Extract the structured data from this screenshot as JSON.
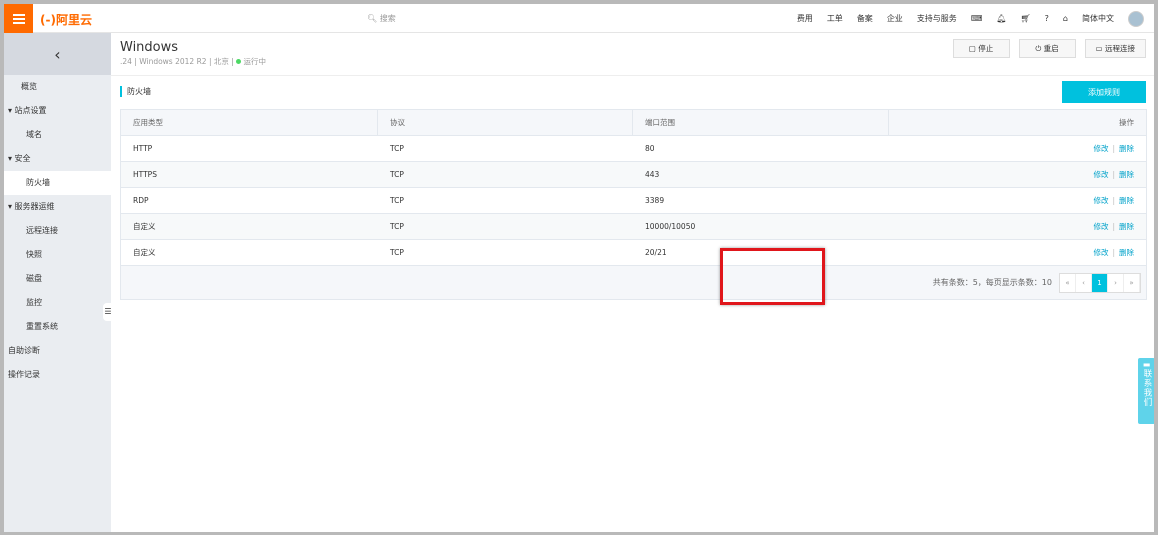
{
  "header": {
    "logo": "(-)阿里云",
    "search_placeholder": "搜索",
    "nav": [
      "费用",
      "工单",
      "备案",
      "企业",
      "支持与服务"
    ],
    "language": "简体中文"
  },
  "sidebar": {
    "items": [
      {
        "label": "概览",
        "type": "item"
      },
      {
        "label": "▾ 站点设置",
        "type": "grp"
      },
      {
        "label": "域名",
        "type": "sub"
      },
      {
        "label": "▾ 安全",
        "type": "grp"
      },
      {
        "label": "防火墙",
        "type": "sub",
        "active": true
      },
      {
        "label": "▾ 服务器运维",
        "type": "grp"
      },
      {
        "label": "远程连接",
        "type": "sub"
      },
      {
        "label": "快照",
        "type": "sub"
      },
      {
        "label": "磁盘",
        "type": "sub"
      },
      {
        "label": "监控",
        "type": "sub"
      },
      {
        "label": "重置系统",
        "type": "sub"
      },
      {
        "label": "自助诊断",
        "type": "grp"
      },
      {
        "label": "操作记录",
        "type": "grp"
      }
    ]
  },
  "instance": {
    "title": "Windows",
    "ip": ".24",
    "os": "Windows 2012 R2",
    "region": "北京",
    "status": "运行中",
    "status_color": "#4cd964"
  },
  "actions": {
    "stop": "停止",
    "restart": "重启",
    "remote": "远程连接"
  },
  "firewall": {
    "title": "防火墙",
    "add_button": "添加规则",
    "columns": [
      "应用类型",
      "协议",
      "端口范围",
      "操作"
    ],
    "rows": [
      [
        "HTTP",
        "TCP",
        "80"
      ],
      [
        "HTTPS",
        "TCP",
        "443"
      ],
      [
        "RDP",
        "TCP",
        "3389"
      ],
      [
        "自定义",
        "TCP",
        "10000/10050"
      ],
      [
        "自定义",
        "TCP",
        "20/21"
      ]
    ],
    "edit": "修改",
    "delete": "删除",
    "summary": "共有条数：5，每页显示条数：10",
    "pagination": [
      "«",
      "‹",
      "1",
      "›",
      "»"
    ],
    "current_page": "1"
  },
  "contact": "联系我们",
  "accent_color": "#00c1de",
  "brand_color": "#ff6a00",
  "highlight_color": "#e0161b"
}
